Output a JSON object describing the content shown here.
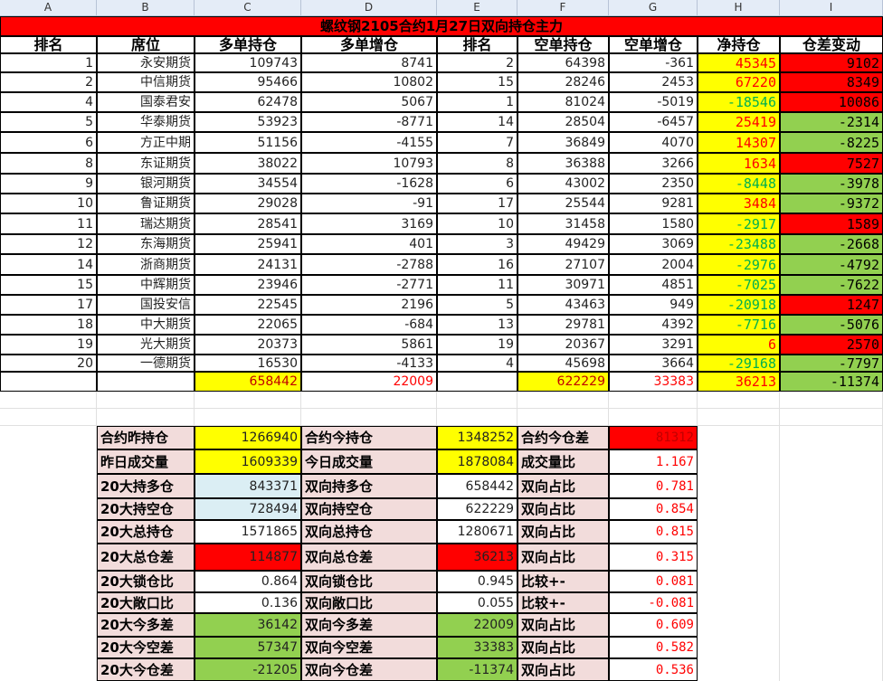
{
  "columns": [
    "A",
    "B",
    "C",
    "D",
    "E",
    "F",
    "G",
    "H",
    "I"
  ],
  "title": "螺纹钢2105合约1月27日双向持仓主力",
  "headers": [
    "排名",
    "席位",
    "多单持仓",
    "多单增仓",
    "排名",
    "空单持仓",
    "空单增仓",
    "净持仓",
    "仓差变动"
  ],
  "rows": [
    [
      "1",
      "永安期货",
      "109743",
      "8741",
      "2",
      "64398",
      "-361",
      "45345",
      "9102"
    ],
    [
      "2",
      "中信期货",
      "95466",
      "10802",
      "15",
      "28246",
      "2453",
      "67220",
      "8349"
    ],
    [
      "4",
      "国泰君安",
      "62478",
      "5067",
      "1",
      "81024",
      "-5019",
      "-18546",
      "10086"
    ],
    [
      "5",
      "华泰期货",
      "53923",
      "-8771",
      "14",
      "28504",
      "-6457",
      "25419",
      "-2314"
    ],
    [
      "6",
      "方正中期",
      "51156",
      "-4155",
      "7",
      "36849",
      "4070",
      "14307",
      "-8225"
    ],
    [
      "8",
      "东证期货",
      "38022",
      "10793",
      "8",
      "36388",
      "3266",
      "1634",
      "7527"
    ],
    [
      "9",
      "银河期货",
      "34554",
      "-1628",
      "6",
      "43002",
      "2350",
      "-8448",
      "-3978"
    ],
    [
      "10",
      "鲁证期货",
      "29028",
      "-91",
      "17",
      "25544",
      "9281",
      "3484",
      "-9372"
    ],
    [
      "11",
      "瑞达期货",
      "28541",
      "3169",
      "10",
      "31458",
      "1580",
      "-2917",
      "1589"
    ],
    [
      "12",
      "东海期货",
      "25941",
      "401",
      "3",
      "49429",
      "3069",
      "-23488",
      "-2668"
    ],
    [
      "14",
      "浙商期货",
      "24131",
      "-2788",
      "16",
      "27107",
      "2004",
      "-2976",
      "-4792"
    ],
    [
      "15",
      "中辉期货",
      "23946",
      "-2771",
      "11",
      "30971",
      "4851",
      "-7025",
      "-7622"
    ],
    [
      "17",
      "国投安信",
      "22545",
      "2196",
      "5",
      "43463",
      "949",
      "-20918",
      "1247"
    ],
    [
      "18",
      "中大期货",
      "22065",
      "-684",
      "13",
      "29781",
      "4392",
      "-7716",
      "-5076"
    ],
    [
      "19",
      "光大期货",
      "20373",
      "5861",
      "19",
      "20367",
      "3291",
      "6",
      "2570"
    ],
    [
      "20",
      "一德期货",
      "16530",
      "-4133",
      "4",
      "45698",
      "3664",
      "-29168",
      "-7797"
    ]
  ],
  "totals": {
    "long": "658442",
    "long_add": "22009",
    "short": "622229",
    "short_add": "33383",
    "net": "36213",
    "diff": "-11374"
  },
  "summary": [
    [
      "合约昨持仓",
      "1266940",
      "合约今持仓",
      "1348252",
      "合约今仓差",
      "81312"
    ],
    [
      "昨日成交量",
      "1609339",
      "今日成交量",
      "1878084",
      "成交量比",
      "1.167"
    ],
    [
      "20大持多仓",
      "843371",
      "双向持多仓",
      "658442",
      "双向占比",
      "0.781"
    ],
    [
      "20大持空仓",
      "728494",
      "双向持空仓",
      "622229",
      "双向占比",
      "0.854"
    ],
    [
      "20大总持仓",
      "1571865",
      "双向总持仓",
      "1280671",
      "双向占比",
      "0.815"
    ],
    [
      "20大总仓差",
      "114877",
      "双向总仓差",
      "36213",
      "双向占比",
      "0.315"
    ],
    [
      "20大锁仓比",
      "0.864",
      "双向锁仓比",
      "0.945",
      "比较+-",
      "0.081"
    ],
    [
      "20大敞口比",
      "0.136",
      "双向敞口比",
      "0.055",
      "比较+-",
      "-0.081"
    ],
    [
      "20大今多差",
      "36142",
      "双向今多差",
      "22009",
      "双向占比",
      "0.609"
    ],
    [
      "20大今空差",
      "57347",
      "双向今空差",
      "33383",
      "双向占比",
      "0.582"
    ],
    [
      "20大今仓差",
      "-21205",
      "双向今仓差",
      "-11374",
      "双向占比",
      "0.536"
    ]
  ],
  "colors": {
    "yellow": "#ffff00",
    "red": "#ff0000",
    "green": "#92d050",
    "pink": "#f2dcdb"
  }
}
